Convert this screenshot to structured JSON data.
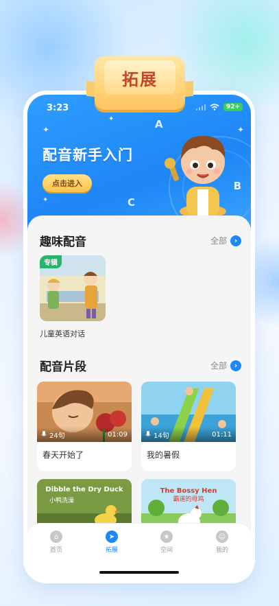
{
  "badge": {
    "text": "拓展"
  },
  "status_bar": {
    "time": "3:23",
    "battery": "92+"
  },
  "hero": {
    "title": "配音新手入门",
    "button_label": "点击进入",
    "decor_letters": [
      "A",
      "B",
      "C"
    ]
  },
  "fun_dubbing": {
    "title": "趣味配音",
    "more_label": "全部",
    "albums": [
      {
        "tag": "专辑",
        "title": "儿童英语对话"
      }
    ]
  },
  "clips": {
    "title": "配音片段",
    "more_label": "全部",
    "items": [
      {
        "title": "春天开始了",
        "sentences": "24句",
        "duration": "01:09"
      },
      {
        "title": "我的暑假",
        "sentences": "14句",
        "duration": "01:11"
      },
      {
        "title": "",
        "cover_text": "Dibble the Dry Duck",
        "cover_subtext": "小鸭洗澡"
      },
      {
        "title": "",
        "cover_text": "The Bossy Hen",
        "cover_subtext": "霸道的母鸡"
      }
    ]
  },
  "tabbar": {
    "tabs": [
      {
        "label": "首页",
        "active": false
      },
      {
        "label": "拓展",
        "active": true
      },
      {
        "label": "空间",
        "active": false
      },
      {
        "label": "我的",
        "active": false
      }
    ]
  },
  "colors": {
    "primary": "#1e88f5",
    "badge_text": "#c2472b",
    "album_tag": "#28b46a"
  }
}
